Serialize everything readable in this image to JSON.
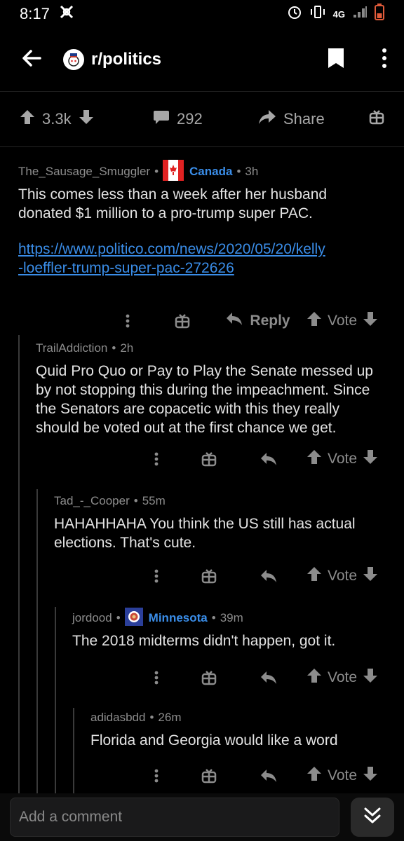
{
  "status": {
    "time": "8:17",
    "network": "4G"
  },
  "header": {
    "subreddit": "r/politics"
  },
  "post_actions": {
    "upvotes": "3.3k",
    "comments": "292",
    "share_label": "Share"
  },
  "comments": [
    {
      "author": "The_Sausage_Smuggler",
      "flair": "Canada",
      "age": "3h",
      "body": "This comes less than a week after her husband donated $1 million to a pro-trump super PAC.",
      "link": "https://www.politico.com/news/2020/05/20/kelly-loeffler-trump-super-pac-272626",
      "link_line1": "https://www.politico.com/news/2020/05/20/kelly",
      "link_line2": "-loeffler-trump-super-pac-272626",
      "reply_label": "Reply",
      "vote_label": "Vote"
    },
    {
      "author": "TrailAddiction",
      "age": "2h",
      "body": "Quid Pro Quo or Pay to Play the Senate messed up by not stopping this during the impeachment. Since the Senators are copacetic with this they really should be voted out at the first chance we get.",
      "vote_label": "Vote"
    },
    {
      "author": "Tad_-_Cooper",
      "age": "55m",
      "body": "HAHAHHAHA You think the US still has actual elections. That's cute.",
      "vote_label": "Vote"
    },
    {
      "author": "jordood",
      "flair": "Minnesota",
      "age": "39m",
      "body": "The 2018 midterms didn't happen, got it.",
      "vote_label": "Vote"
    },
    {
      "author": "adidasbdd",
      "age": "26m",
      "body": "Florida and Georgia would like a word",
      "vote_label": "Vote"
    }
  ],
  "bottom": {
    "comment_placeholder": "Add a comment"
  },
  "colors": {
    "link": "#3a8de8",
    "background": "#000000",
    "muted": "#8c8c8c"
  },
  "icons": [
    "back-arrow-icon",
    "bookmark-icon",
    "more-vert-icon",
    "upvote-icon",
    "downvote-icon",
    "comment-icon",
    "share-icon",
    "award-icon",
    "reply-icon",
    "chevron-down-double-icon"
  ]
}
